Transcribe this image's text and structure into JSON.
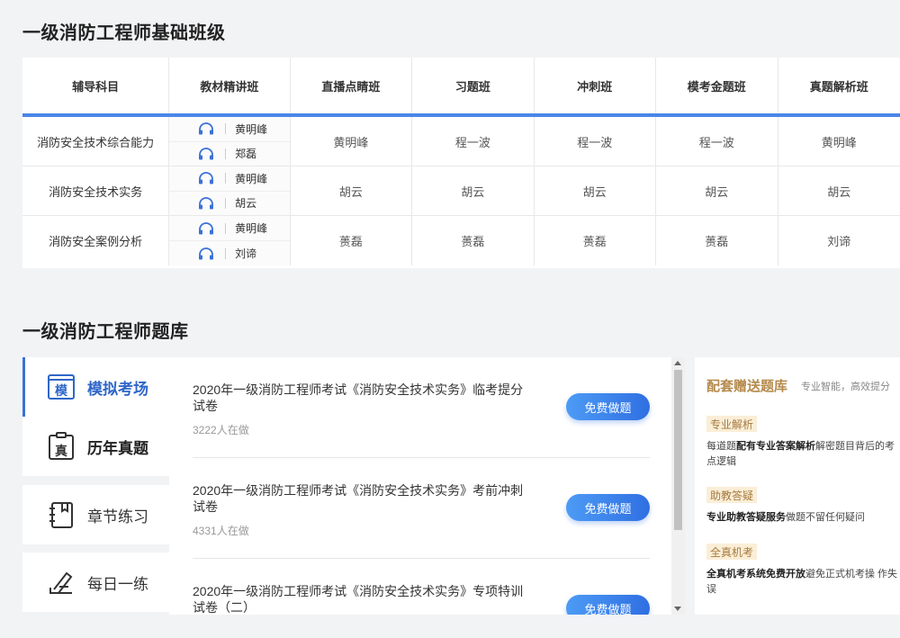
{
  "class_section": {
    "title": "一级消防工程师基础班级",
    "headers": [
      "辅导科目",
      "教材精讲班",
      "直播点睛班",
      "习题班",
      "冲刺班",
      "模考金题班",
      "真题解析班"
    ],
    "rows": [
      {
        "subject": "消防安全技术综合能力",
        "teachers": [
          "黄明峰",
          "郑磊"
        ],
        "cells": [
          "黄明峰",
          "程一波",
          "程一波",
          "程一波",
          "黄明峰"
        ]
      },
      {
        "subject": "消防安全技术实务",
        "teachers": [
          "黄明峰",
          "胡云"
        ],
        "cells": [
          "胡云",
          "胡云",
          "胡云",
          "胡云",
          "胡云"
        ]
      },
      {
        "subject": "消防安全案例分析",
        "teachers": [
          "黄明峰",
          "刘谛"
        ],
        "cells": [
          "蒉磊",
          "蒉磊",
          "蒉磊",
          "蒉磊",
          "刘谛"
        ]
      }
    ]
  },
  "bank_section": {
    "title": "一级消防工程师题库",
    "tabs": [
      {
        "label": "模拟考场",
        "icon_char": "模",
        "icon": "mock-exam-icon"
      },
      {
        "label": "历年真题",
        "icon_char": "真",
        "icon": "past-papers-icon"
      },
      {
        "label": "章节练习",
        "icon": "notebook-icon"
      },
      {
        "label": "每日一练",
        "icon": "pen-icon"
      }
    ],
    "papers": [
      {
        "title": "2020年一级消防工程师考试《消防安全技术实务》临考提分试卷",
        "count": "3222人在做",
        "button": "免费做题"
      },
      {
        "title": "2020年一级消防工程师考试《消防安全技术实务》考前冲刺试卷",
        "count": "4331人在做",
        "button": "免费做题"
      },
      {
        "title": "2020年一级消防工程师考试《消防安全技术实务》专项特训试卷（二）",
        "count": "",
        "button": "免费做题"
      }
    ],
    "side": {
      "title": "配套赠送题库",
      "subtitle": "专业智能，高效提分",
      "features": [
        {
          "tag": "专业解析",
          "pre": "每道题",
          "bold": "配有专业答案解析",
          "post": "解密题目背后的考点逻辑"
        },
        {
          "tag": "助教答疑",
          "pre": "",
          "bold": "专业助教答疑服务",
          "post": "做题不留任何疑问"
        },
        {
          "tag": "全真机考",
          "pre": "",
          "bold": "全真机考系统免费开放",
          "post": "避免正式机考操 作失误"
        }
      ]
    }
  }
}
